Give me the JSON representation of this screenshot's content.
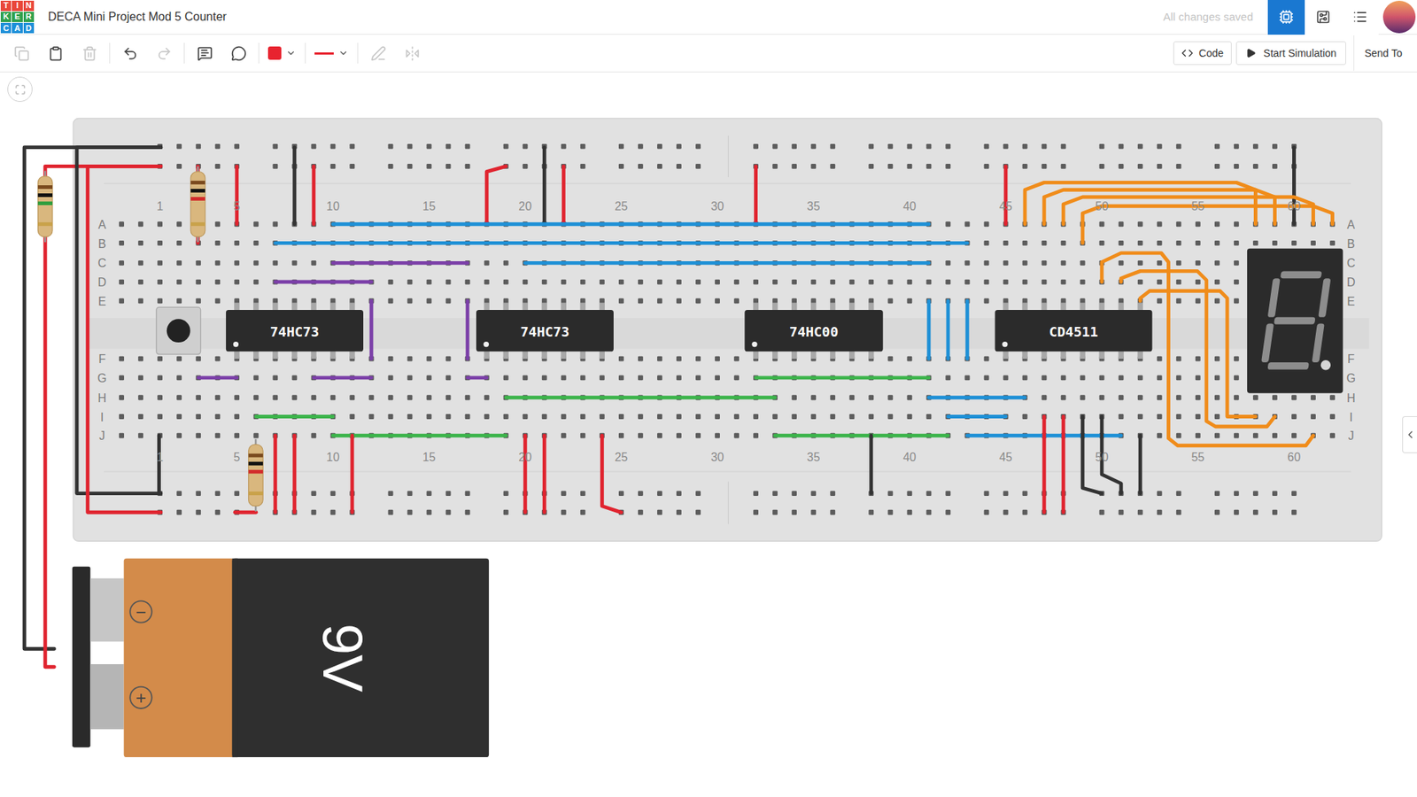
{
  "window": {
    "title": "DECA Mini Project Mod 5 Counter"
  },
  "logo": [
    {
      "letter": "T",
      "color": "#e9473b"
    },
    {
      "letter": "I",
      "color": "#e9473b"
    },
    {
      "letter": "N",
      "color": "#e9473b"
    },
    {
      "letter": "K",
      "color": "#30a14e"
    },
    {
      "letter": "E",
      "color": "#30a14e"
    },
    {
      "letter": "R",
      "color": "#30a14e"
    },
    {
      "letter": "C",
      "color": "#1d8fd8"
    },
    {
      "letter": "A",
      "color": "#1d8fd8"
    },
    {
      "letter": "D",
      "color": "#1d8fd8"
    }
  ],
  "save_status": "All changes saved",
  "view_modes": [
    {
      "selected": true
    },
    {
      "selected": false
    },
    {
      "selected": false
    }
  ],
  "toolbar": {
    "tools": [
      {
        "disabled": true
      },
      {
        "disabled": false
      },
      {
        "disabled": true
      },
      {
        "disabled": false
      },
      {
        "disabled": true
      },
      {
        "disabled": false
      },
      {
        "disabled": false
      }
    ],
    "wire_color": "#e8232f",
    "line_style_color": "#e8232f",
    "extra_tools": [
      {
        "disabled": true
      },
      {
        "disabled": true
      }
    ]
  },
  "actions": [
    {
      "label": "Code"
    },
    {
      "label": "Start Simulation"
    },
    {
      "label": "Send To"
    }
  ],
  "breadboard": {
    "column_labels": [
      "1",
      "5",
      "10",
      "15",
      "20",
      "25",
      "30",
      "35",
      "40",
      "45",
      "50",
      "55",
      "60"
    ],
    "row_labels": [
      "A",
      "B",
      "C",
      "D",
      "E",
      "F",
      "G",
      "H",
      "I",
      "J"
    ]
  },
  "chips": [
    {
      "label": "74HC73"
    },
    {
      "label": "74HC73"
    },
    {
      "label": "74HC00"
    },
    {
      "label": "CD4511"
    }
  ],
  "battery": {
    "label": "9V",
    "negative": "−",
    "positive": "+"
  },
  "display": {
    "segments": [
      false,
      false,
      false,
      false,
      false,
      false,
      false
    ],
    "decimal_point": false
  }
}
